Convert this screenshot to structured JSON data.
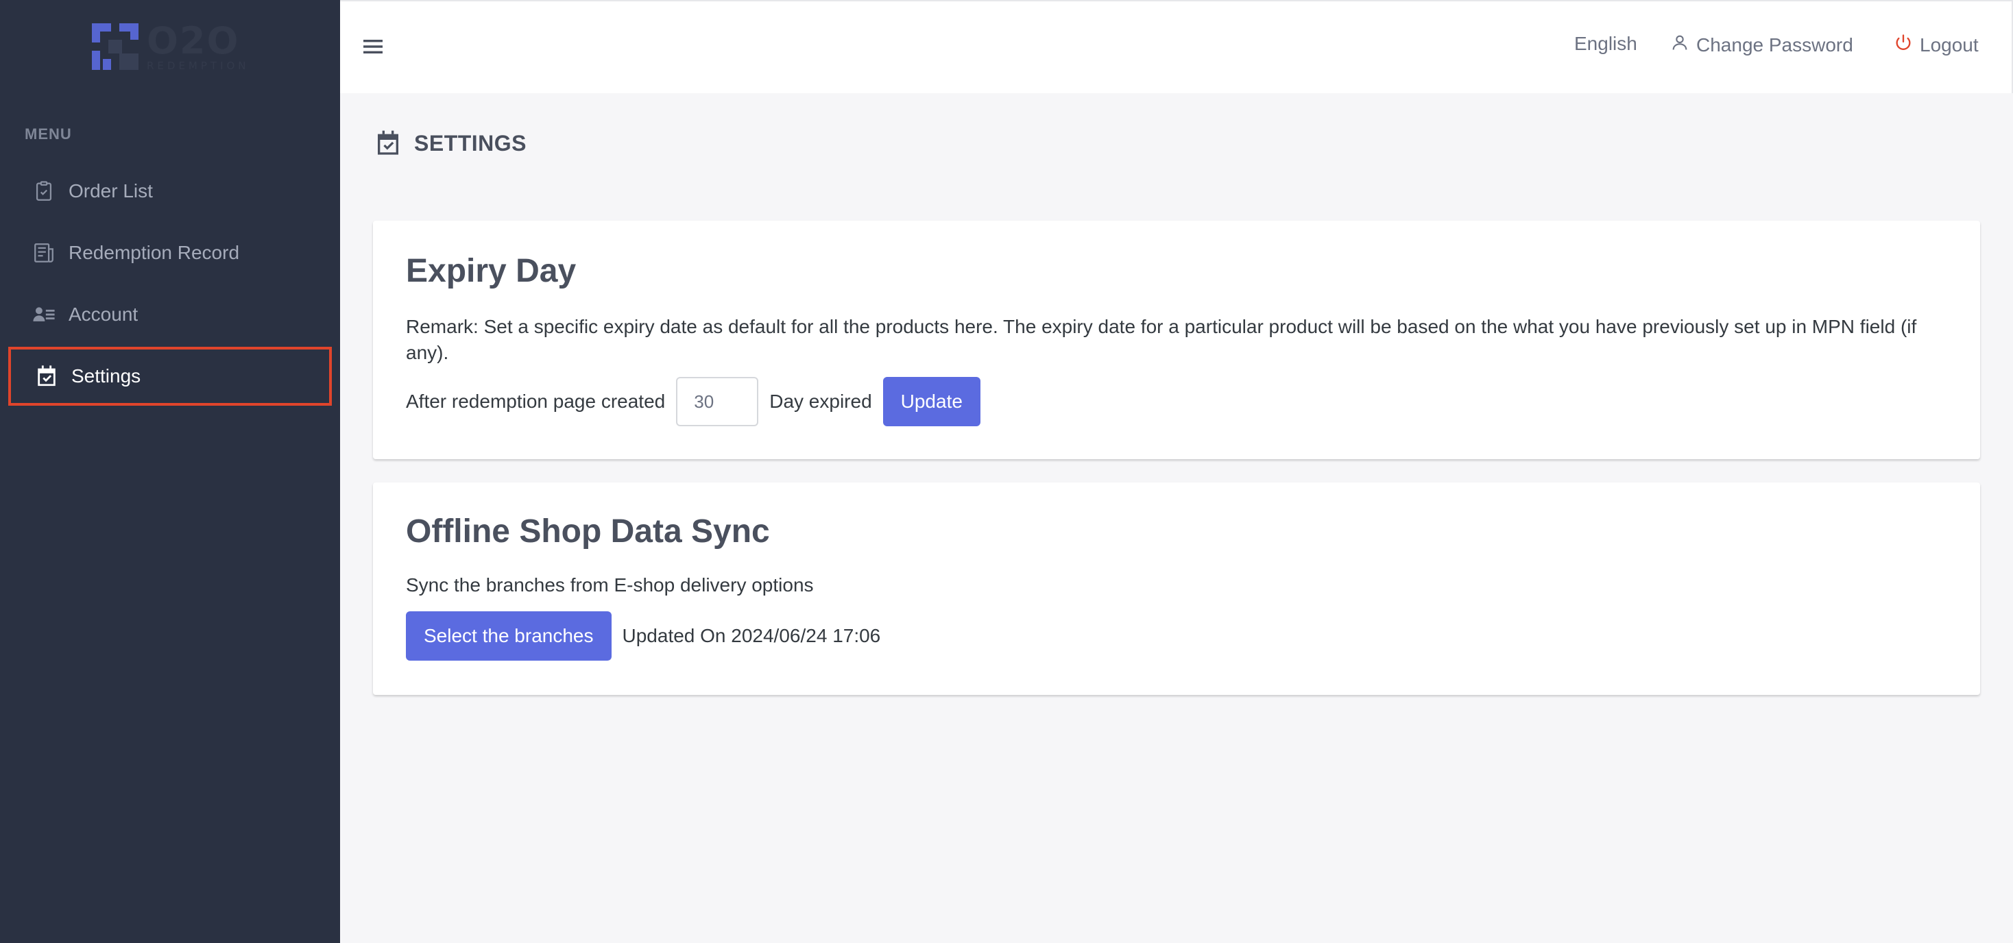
{
  "brand": {
    "logo_text": "O2O",
    "logo_sub": "REDEMPTION"
  },
  "sidebar": {
    "menu_heading": "MENU",
    "items": [
      {
        "label": "Order List",
        "icon": "clipboard-check-icon",
        "active": false
      },
      {
        "label": "Redemption Record",
        "icon": "receipt-icon",
        "active": false
      },
      {
        "label": "Account",
        "icon": "user-list-icon",
        "active": false
      },
      {
        "label": "Settings",
        "icon": "calendar-check-icon",
        "active": true
      }
    ]
  },
  "topbar": {
    "language": "English",
    "change_password": "Change Password",
    "logout": "Logout"
  },
  "page": {
    "title": "SETTINGS"
  },
  "expiry": {
    "title": "Expiry Day",
    "remark": "Remark: Set a specific expiry date as default for all the products here. The expiry date for a particular product will be based on the what you have previously set up in MPN field (if any).",
    "before_input": "After redemption page created",
    "days_value": "30",
    "after_input": "Day expired",
    "update_label": "Update"
  },
  "sync": {
    "title": "Offline Shop Data Sync",
    "description": "Sync the branches from E-shop delivery options",
    "select_label": "Select the branches",
    "updated_text": "Updated On 2024/06/24 17:06"
  },
  "colors": {
    "sidebar_bg": "#2a3142",
    "accent": "#5b6be0",
    "highlight_border": "#e0442b",
    "logout_icon": "#e0442b"
  }
}
